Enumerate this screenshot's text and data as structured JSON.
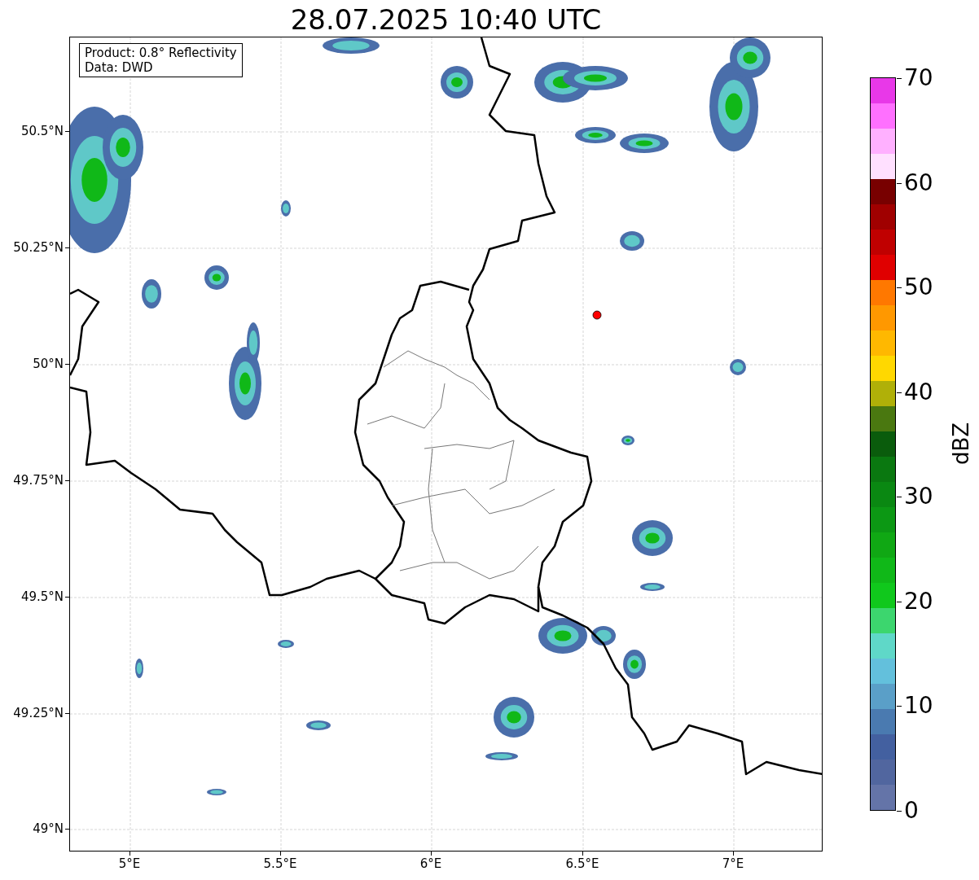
{
  "title": "28.07.2025 10:40 UTC",
  "annotation": [
    "Product: 0.8° Reflectivity",
    "Data: DWD"
  ],
  "x_ticks": [
    "5°E",
    "5.5°E",
    "6°E",
    "6.5°E",
    "7°E"
  ],
  "y_ticks": [
    "50.5°N",
    "50.25°N",
    "50°N",
    "49.75°N",
    "49.5°N",
    "49.25°N",
    "49°N"
  ],
  "colorbar": {
    "label": "dBZ",
    "ticks": [
      "70",
      "60",
      "50",
      "40",
      "30",
      "20",
      "10",
      "0"
    ],
    "segments": [
      {
        "color": "#e838e8"
      },
      {
        "color": "#ff70ff"
      },
      {
        "color": "#ffb0ff"
      },
      {
        "color": "#ffe0ff"
      },
      {
        "color": "#780000"
      },
      {
        "color": "#a00000"
      },
      {
        "color": "#c00000"
      },
      {
        "color": "#e00000"
      },
      {
        "color": "#ff7800"
      },
      {
        "color": "#ff9800"
      },
      {
        "color": "#ffb800"
      },
      {
        "color": "#ffd800"
      },
      {
        "color": "#b0b008"
      },
      {
        "color": "#4a7810"
      },
      {
        "color": "#0a5c0c"
      },
      {
        "color": "#0a7810"
      },
      {
        "color": "#0a8812"
      },
      {
        "color": "#0c9814"
      },
      {
        "color": "#10a814"
      },
      {
        "color": "#10b818"
      },
      {
        "color": "#10c81c"
      },
      {
        "color": "#3cd66e"
      },
      {
        "color": "#5fd8c8"
      },
      {
        "color": "#63c0dc"
      },
      {
        "color": "#5a9fc8"
      },
      {
        "color": "#4a7ab0"
      },
      {
        "color": "#4360a0"
      },
      {
        "color": "#51669f"
      },
      {
        "color": "#6474a8"
      }
    ]
  }
}
